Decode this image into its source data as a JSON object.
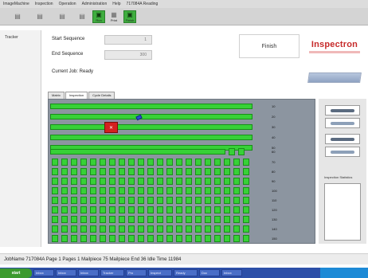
{
  "menubar": {
    "items": [
      "ImageMachine",
      "Inspection",
      "Operation",
      "Administration",
      "Help",
      "717084A Reading"
    ]
  },
  "toolbar": {
    "buttons": [
      {
        "glyph": "▤",
        "label": ""
      },
      {
        "glyph": "▤",
        "label": ""
      },
      {
        "glyph": "▤",
        "label": ""
      },
      {
        "glyph": "▤",
        "label": ""
      },
      {
        "glyph": "▣",
        "label": "Run"
      },
      {
        "glyph": "▦",
        "label": "Print"
      },
      {
        "glyph": "▣",
        "label": "Finish"
      }
    ]
  },
  "left_tab": {
    "label": "Tracker"
  },
  "form": {
    "start_label": "Start Sequence",
    "start_value": "1",
    "end_label": "End Sequence",
    "end_value": "300",
    "current_job": "Current Job: Ready"
  },
  "finish_button": "Finish",
  "brand": {
    "name": "Inspectron"
  },
  "tabs": [
    "Matrix",
    "Inspection",
    "Cycle Details"
  ],
  "matrix": {
    "row_numbers": [
      "10",
      "20",
      "30",
      "40",
      "50",
      "60",
      "70",
      "80",
      "90",
      "100",
      "110",
      "120",
      "130",
      "140",
      "150"
    ],
    "colors": {
      "pass": "#37d137",
      "fail": "#d42020",
      "panel": "#8c95a0"
    }
  },
  "right_panel": {
    "inspect_label": "Inspection Statistics"
  },
  "status": {
    "text": "JobName  717084A   Page  1   Pages  1   Mailpiece  75   Mailpiece End  36   Idle Time  11984"
  },
  "taskbar": {
    "start_label": "start",
    "items": [
      "Inbox",
      "Inbox",
      "Inbox",
      "Tracker",
      "Pro",
      "Inspect",
      "Ready",
      "Doc",
      "Inbox"
    ]
  }
}
